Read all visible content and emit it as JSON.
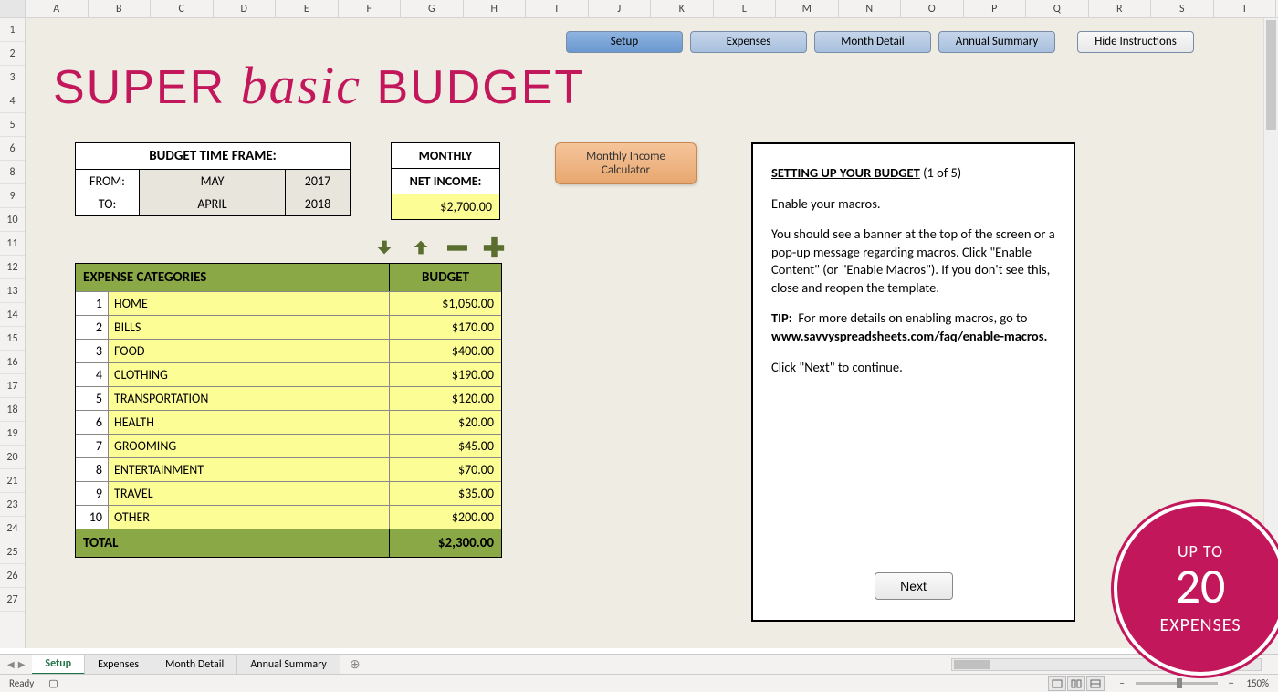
{
  "columns": [
    "A",
    "B",
    "C",
    "D",
    "E",
    "F",
    "G",
    "H",
    "I",
    "J",
    "K",
    "L",
    "M",
    "N",
    "O",
    "P",
    "Q",
    "R",
    "S",
    "T"
  ],
  "rows": [
    "1",
    "2",
    "3",
    "4",
    "5",
    "6",
    "8",
    "9",
    "10",
    "11",
    "12",
    "13",
    "14",
    "15",
    "16",
    "17",
    "18",
    "19",
    "20",
    "21",
    "23",
    "24",
    "25",
    "26",
    "27"
  ],
  "title_super": "SUPER",
  "title_basic": "basic",
  "title_budget": "BUDGET",
  "nav": {
    "setup": "Setup",
    "expenses": "Expenses",
    "month": "Month Detail",
    "annual": "Annual Summary",
    "hide": "Hide Instructions"
  },
  "timeframe": {
    "header": "BUDGET TIME FRAME:",
    "from_label": "FROM:",
    "from_month": "MAY",
    "from_year": "2017",
    "to_label": "TO:",
    "to_month": "APRIL",
    "to_year": "2018"
  },
  "netincome": {
    "monthly": "MONTHLY",
    "label": "NET INCOME:",
    "value": "$2,700.00"
  },
  "calc_btn": {
    "line1": "Monthly Income",
    "line2": "Calculator"
  },
  "instructions": {
    "title": "SETTING UP YOUR BUDGET",
    "count": "(1 of 5)",
    "p1": "Enable your macros.",
    "p2": "You should see a banner at the top of the screen or a pop-up message regarding macros. Click \"Enable Content\" (or \"Enable Macros\"). If you don't see this, close and reopen the template.",
    "tip_label": "TIP:",
    "tip_text": "For more details on enabling macros, go to",
    "tip_link": "www.savvyspreadsheets.com/faq/enable-macros.",
    "p4": "Click \"Next\" to continue.",
    "next": "Next"
  },
  "categories": {
    "header_name": "EXPENSE CATEGORIES",
    "header_budget": "BUDGET",
    "rows": [
      {
        "n": "1",
        "name": "HOME",
        "amt": "$1,050.00"
      },
      {
        "n": "2",
        "name": "BILLS",
        "amt": "$170.00"
      },
      {
        "n": "3",
        "name": "FOOD",
        "amt": "$400.00"
      },
      {
        "n": "4",
        "name": "CLOTHING",
        "amt": "$190.00"
      },
      {
        "n": "5",
        "name": "TRANSPORTATION",
        "amt": "$120.00"
      },
      {
        "n": "6",
        "name": "HEALTH",
        "amt": "$20.00"
      },
      {
        "n": "7",
        "name": "GROOMING",
        "amt": "$45.00"
      },
      {
        "n": "8",
        "name": "ENTERTAINMENT",
        "amt": "$70.00"
      },
      {
        "n": "9",
        "name": "TRAVEL",
        "amt": "$35.00"
      },
      {
        "n": "10",
        "name": "OTHER",
        "amt": "$200.00"
      }
    ],
    "total_label": "TOTAL",
    "total_amt": "$2,300.00"
  },
  "badge": {
    "l1": "UP TO",
    "l2": "20",
    "l3": "EXPENSES"
  },
  "tabs": {
    "setup": "Setup",
    "expenses": "Expenses",
    "month": "Month Detail",
    "annual": "Annual Summary"
  },
  "status": {
    "ready": "Ready",
    "zoom": "150%"
  }
}
